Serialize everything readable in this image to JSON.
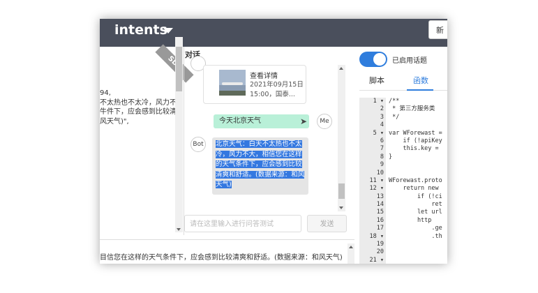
{
  "header": {
    "title": "intents",
    "new_button": "新"
  },
  "left_panel": {
    "badge": "SDK",
    "lines": [
      "94,",
      "不太热也不太冷，风力不",
      "牛件下，应会感到比较清",
      "风天气)\","
    ]
  },
  "chat": {
    "title": "对话",
    "card": {
      "title": "查看详情",
      "line1": "2021年09月15日",
      "line2": "15:00，国泰..."
    },
    "user_message": "今天北京天气",
    "user_avatar": "Me",
    "bot_avatar": "Bot",
    "bot_reply": "北京天气：白天不太热也不太冷，风力不大，相信您在这样的天气条件下，应会感到比较清爽和舒适。(数据来源：和风天气)",
    "input_placeholder": "请在这里输入进行问答测试",
    "send_button": "发送"
  },
  "bottom_text": "目信您在这样的天气条件下，应会感到比较清爽和舒适。(数据来源：和风天气)",
  "right_panel": {
    "toggle_label": "已启用话题",
    "toggle_on": true,
    "tabs": [
      "脚本",
      "函数"
    ],
    "active_tab": "函数",
    "accent_color": "#2f7ddd",
    "gutter": [
      "1 ▾",
      "2",
      "3",
      "4",
      "5 ▾",
      "6",
      "7",
      "8",
      "9",
      "10",
      "11 ▾",
      "12 ▾",
      "13",
      "14",
      "15",
      "16",
      "17",
      "18 ▾",
      "19",
      "20",
      "21 ▾"
    ],
    "code": [
      "/**",
      " * 第三方服务类",
      " */",
      "",
      "var WForewast =",
      "    if (!apiKey",
      "    this.key =",
      "}",
      "",
      "",
      "WForewast.proto",
      "    return new",
      "        if (!ci",
      "            ret",
      "        let url",
      "        http",
      "            .ge",
      "            .th",
      "",
      "",
      ""
    ]
  }
}
